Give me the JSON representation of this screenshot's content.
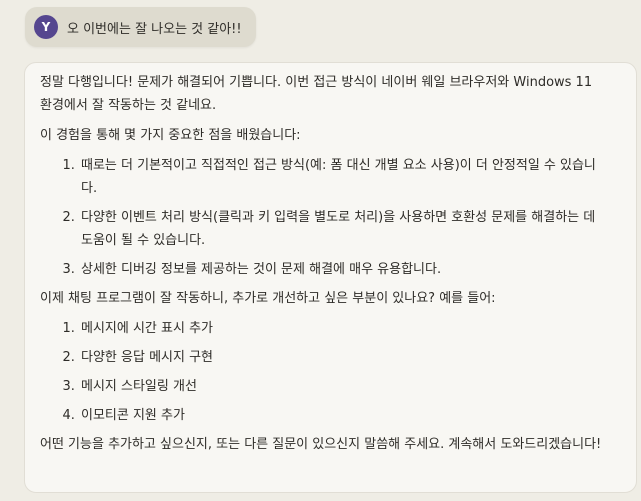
{
  "user_message": {
    "avatar_initial": "Y",
    "text": "오 이번에는 잘 나오는 것 같아!!"
  },
  "assistant_message": {
    "intro": "정말 다행입니다! 문제가 해결되어 기쁩니다. 이번 접근 방식이 네이버 웨일 브라우저와 Windows 11 환경에서 잘 작동하는 것 같네요.",
    "lessons_heading": "이 경험을 통해 몇 가지 중요한 점을 배웠습니다:",
    "lessons": [
      "때로는 더 기본적이고 직접적인 접근 방식(예: 폼 대신 개별 요소 사용)이 더 안정적일 수 있습니다.",
      "다양한 이벤트 처리 방식(클릭과 키 입력을 별도로 처리)을 사용하면 호환성 문제를 해결하는 데 도움이 될 수 있습니다.",
      "상세한 디버깅 정보를 제공하는 것이 문제 해결에 매우 유용합니다."
    ],
    "improvements_heading": "이제 채팅 프로그램이 잘 작동하니, 추가로 개선하고 싶은 부분이 있나요? 예를 들어:",
    "improvements": [
      "메시지에 시간 표시 추가",
      "다양한 응답 메시지 구현",
      "메시지 스타일링 개선",
      "이모티콘 지원 추가"
    ],
    "closing": "어떤 기능을 추가하고 싶으신지, 또는 다른 질문이 있으신지 말씀해 주세요. 계속해서 도와드리겠습니다!"
  },
  "colors": {
    "background": "#efede5",
    "user_bubble": "#dedbcf",
    "avatar": "#55468f",
    "card": "#f8f7f3",
    "text": "#2e2c28"
  }
}
